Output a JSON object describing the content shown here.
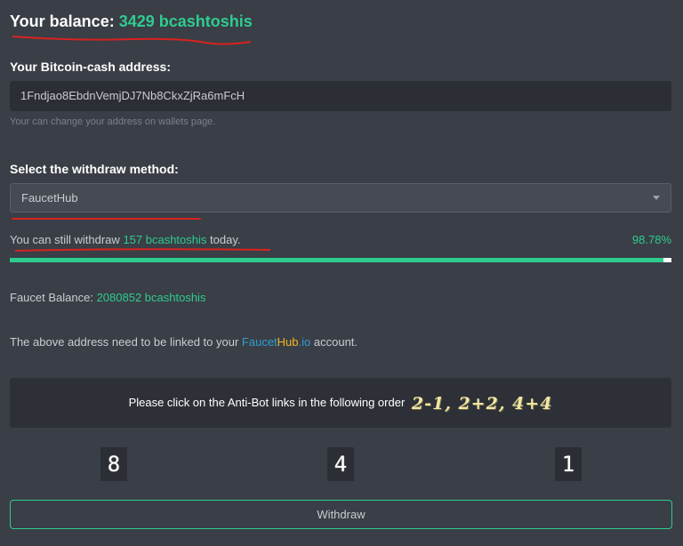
{
  "balance": {
    "label": "Your balance:",
    "value": "3429 bcashtoshis"
  },
  "address": {
    "label": "Your Bitcoin-cash address:",
    "value": "1Fndjao8EbdnVemjDJ7Nb8CkxZjRa6mFcH",
    "hint": "Your can change your address on wallets page."
  },
  "withdraw_method": {
    "label": "Select the withdraw method:",
    "selected": "FaucetHub"
  },
  "limit": {
    "prefix": "You can still withdraw",
    "amount": "157 bcashtoshis",
    "suffix": "today.",
    "percent_text": "98.78%",
    "progress_fraction": 0.9878
  },
  "faucet": {
    "label": "Faucet Balance:",
    "value": "2080852 bcashtoshis"
  },
  "link_note": {
    "prefix": "The above address need to be linked to your",
    "brand_part1": "Faucet",
    "brand_part2": "Hub",
    "brand_part3": ".io",
    "suffix": "account."
  },
  "antibot": {
    "instruction": "Please click on the Anti-Bot links in the following order",
    "order": "2-1, 2+2, 4+4",
    "links": [
      "8",
      "4",
      "1"
    ]
  },
  "withdraw_button": {
    "label": "Withdraw"
  },
  "colors": {
    "accent": "#2ecc8f",
    "background": "#3a3e46",
    "annotation": "#d9221f"
  }
}
